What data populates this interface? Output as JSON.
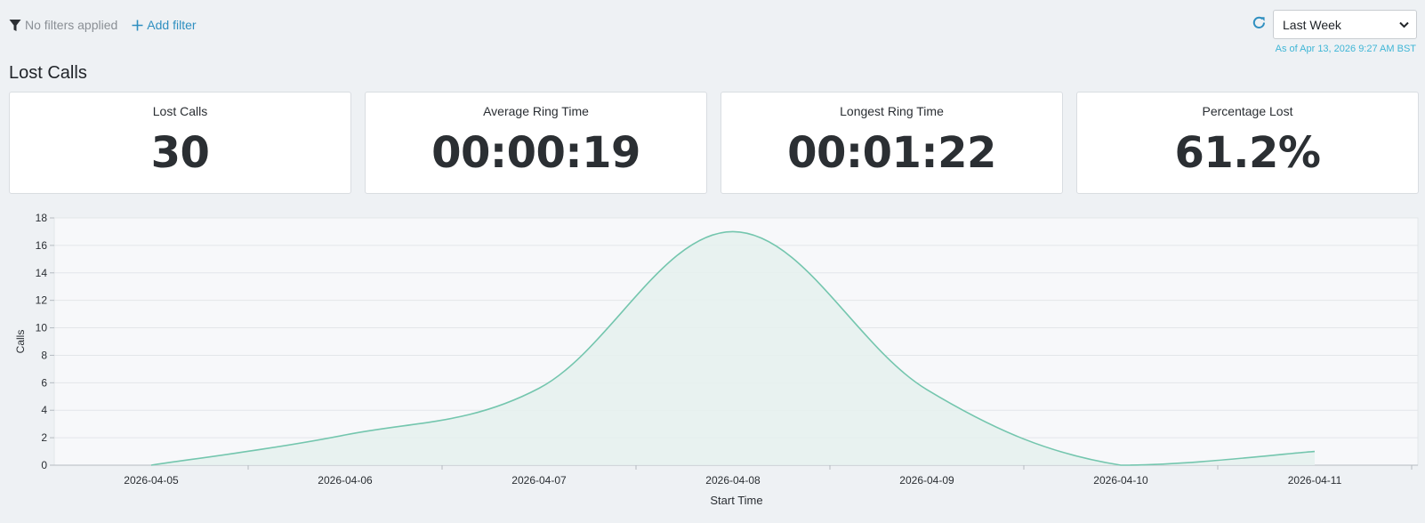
{
  "toolbar": {
    "filter_status": "No filters applied",
    "filter_icon": "filter-icon",
    "add_filter_label": "Add filter",
    "add_filter_icon": "plus-icon",
    "refresh_icon": "refresh-icon",
    "range_selected": "Last Week",
    "as_of": "As of Apr 13, 2026 9:27 AM BST"
  },
  "page": {
    "title": "Lost Calls"
  },
  "cards": [
    {
      "label": "Lost Calls",
      "value": "30"
    },
    {
      "label": "Average Ring Time",
      "value": "00:00:19"
    },
    {
      "label": "Longest Ring Time",
      "value": "00:01:22"
    },
    {
      "label": "Percentage Lost",
      "value": "61.2%"
    }
  ],
  "colors": {
    "accent": "#2f8fc0",
    "series_line": "#74c6ae",
    "series_fill": "#e6f1ee",
    "timestamp": "#3fb6d6"
  },
  "chart_data": {
    "type": "area",
    "x": [
      "2026-04-05",
      "2026-04-06",
      "2026-04-07",
      "2026-04-08",
      "2026-04-09",
      "2026-04-10",
      "2026-04-11"
    ],
    "series": [
      {
        "values": [
          0,
          2.2,
          5.6,
          17,
          5.5,
          0,
          1
        ]
      }
    ],
    "xlabel": "Start Time",
    "ylabel": "Calls",
    "ylim": [
      0,
      18
    ],
    "yticks": [
      0,
      2,
      4,
      6,
      8,
      10,
      12,
      14,
      16,
      18
    ],
    "grid": true,
    "smooth": true
  }
}
